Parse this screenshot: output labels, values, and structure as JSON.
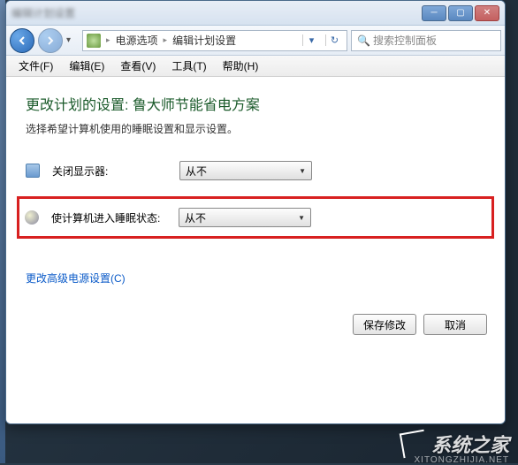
{
  "titlebar": {
    "title": "编辑计划设置"
  },
  "nav": {
    "breadcrumb": [
      "电源选项",
      "编辑计划设置"
    ],
    "search_placeholder": "搜索控制面板"
  },
  "menu": {
    "items": [
      "文件(F)",
      "编辑(E)",
      "查看(V)",
      "工具(T)",
      "帮助(H)"
    ]
  },
  "page": {
    "heading": "更改计划的设置: 鲁大师节能省电方案",
    "subtext": "选择希望计算机使用的睡眠设置和显示设置。",
    "rows": [
      {
        "icon": "monitor-icon",
        "label": "关闭显示器:",
        "value": "从不"
      },
      {
        "icon": "moon-icon",
        "label": "使计算机进入睡眠状态:",
        "value": "从不"
      }
    ],
    "advanced_link": "更改高级电源设置(C)",
    "buttons": {
      "save": "保存修改",
      "cancel": "取消"
    }
  },
  "watermark": {
    "main": "系统之家",
    "sub": "XITONGZHIJIA.NET"
  }
}
